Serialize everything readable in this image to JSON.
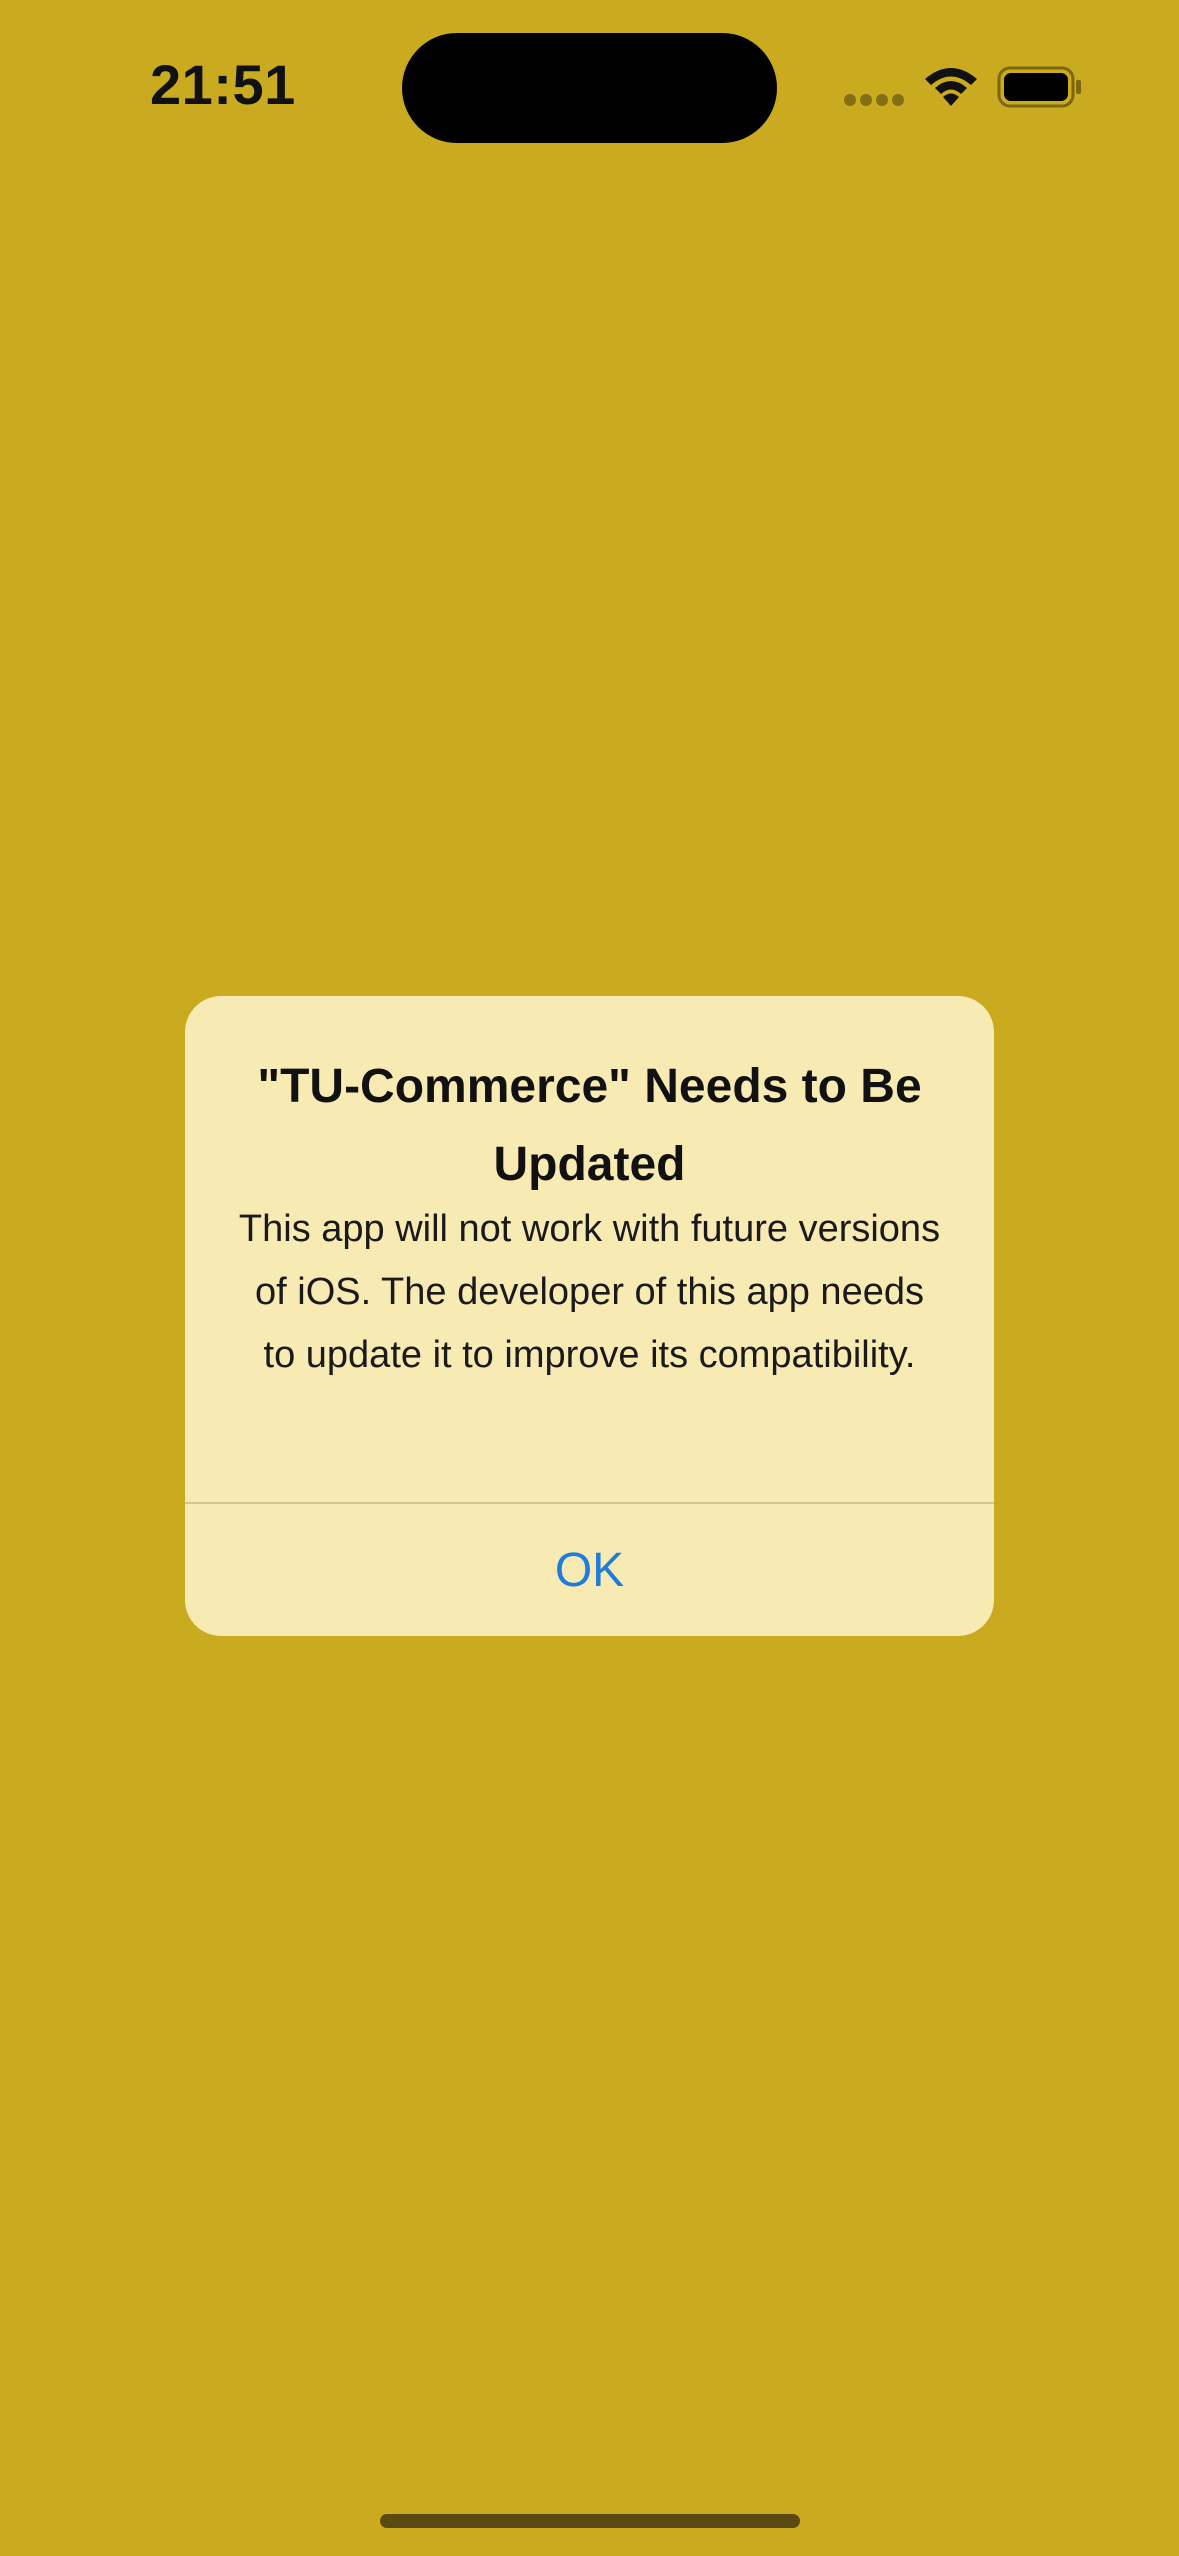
{
  "status_bar": {
    "time": "21:51",
    "icons": [
      "signal-dots-icon",
      "wifi-icon",
      "battery-icon"
    ]
  },
  "alert": {
    "title": "\"TU-Commerce\" Needs to Be Updated",
    "message": "This app will not work with future versions of iOS. The developer of this app needs to update it to improve its compatibility.",
    "button_label": "OK"
  },
  "colors": {
    "background": "#CAAA1F",
    "alert_background": "#F8EAB3",
    "button_text": "#1E7CDC"
  }
}
